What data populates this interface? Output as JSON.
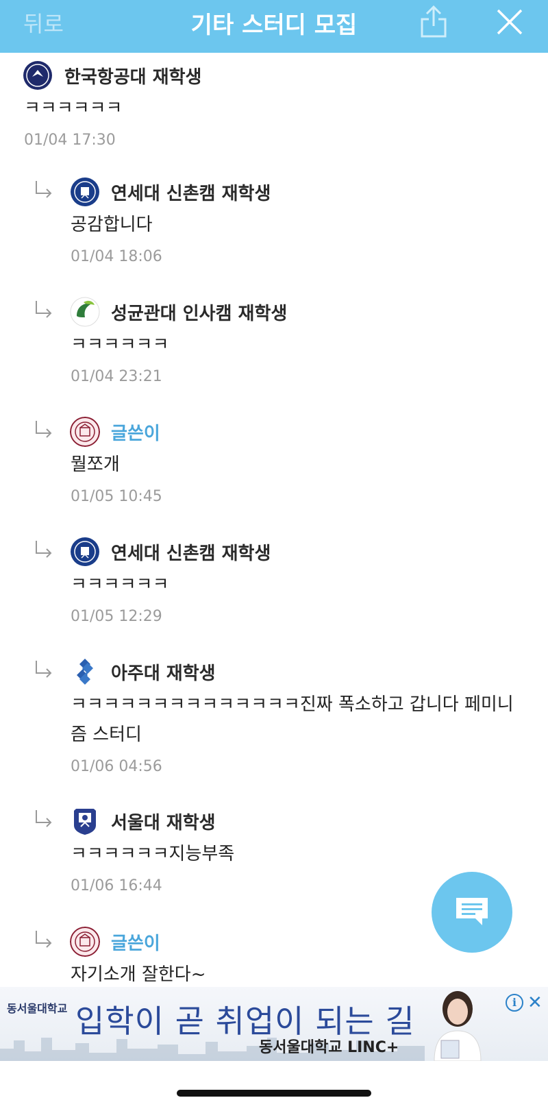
{
  "header": {
    "back_label": "뒤로",
    "title": "기타 스터디 모집",
    "share_icon": "share-icon",
    "close_icon": "close-icon",
    "bg_color": "#6cc6ee"
  },
  "comments": [
    {
      "name": "한국항공대 재학생",
      "text": "ㅋㅋㅋㅋㅋㅋ",
      "time": "01/04 17:30",
      "reply": false,
      "author": false
    },
    {
      "name": "연세대 신촌캠 재학생",
      "text": "공감합니다",
      "time": "01/04 18:06",
      "reply": true,
      "author": false
    },
    {
      "name": "성균관대 인사캠 재학생",
      "text": "ㅋㅋㅋㅋㅋㅋ",
      "time": "01/04 23:21",
      "reply": true,
      "author": false
    },
    {
      "name": "글쓴이",
      "text": "뭘쪼개",
      "time": "01/05 10:45",
      "reply": true,
      "author": true
    },
    {
      "name": "연세대 신촌캠 재학생",
      "text": "ㅋㅋㅋㅋㅋㅋ",
      "time": "01/05 12:29",
      "reply": true,
      "author": false
    },
    {
      "name": "아주대 재학생",
      "text": "ㅋㅋㅋㅋㅋㅋㅋㅋㅋㅋㅋㅋㅋㅋ진짜 폭소하고 갑니다 페미니즘 스터디",
      "time": "01/06 04:56",
      "reply": true,
      "author": false
    },
    {
      "name": "서울대 재학생",
      "text": "ㅋㅋㅋㅋㅋㅋ지능부족",
      "time": "01/06 16:44",
      "reply": true,
      "author": false
    },
    {
      "name": "글쓴이",
      "text": "자기소개 잘한다~",
      "time": "",
      "reply": true,
      "author": true
    }
  ],
  "fab": {
    "icon": "comment-icon"
  },
  "ad": {
    "school": "동서울대학교",
    "headline": "입학이 곧 취업이 되는 길",
    "sub": "동서울대학교 LINC+",
    "info_icon": "info-icon",
    "close_icon": "close-icon"
  },
  "colors": {
    "accent": "#6cc6ee",
    "author": "#4aa6db",
    "time": "#9b9b9b"
  }
}
